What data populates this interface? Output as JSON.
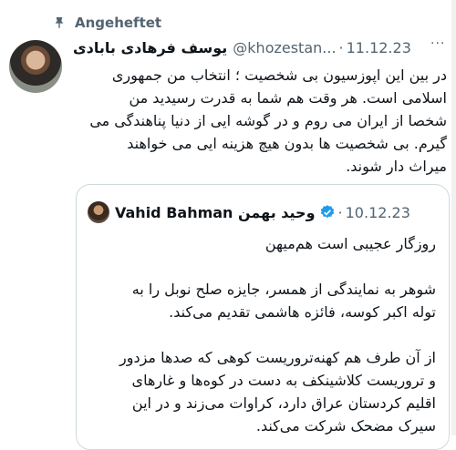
{
  "pinned": {
    "label": "Angeheftet"
  },
  "tweet": {
    "name": "یوسف فرهادی بابادی",
    "handle": "@khozestan...",
    "separator": "·",
    "date": "11.12.23",
    "more": "···",
    "text": "در بین این اپوزسیون بی شخصیت ؛ انتخاب من جمهوری\nاسلامی است. هر وقت هم شما به قدرت رسیدید من\nشخصا از ایران می روم و در گوشه ایی از دنیا پناهندگی می\nگیرم. بی شخصیت ها بدون هیچ هزینه ایی می خواهند\nمیراث دار شوند."
  },
  "quote": {
    "name": "Vahid Bahman وحید بهمن",
    "separator": "·",
    "date": "10.12.23",
    "paragraphs": [
      "روزگار عجیبی است هم‌میهن",
      "شوهر به نمایندگی از همسر، جایزه صلح نوبل را به\nتوله اکبر کوسه، فائزه هاشمی تقدیم می‌کند.",
      "از آن طرف هم کهنه‌تروریست کوهی که صدها مزدور\nو تروریست کلاشینکف به دست در کوه‌ها و غارهای\nاقلیم کردستان عراق دارد، کراوات می‌زند و در این\nسیرک مضحک شرکت می‌کند."
    ]
  },
  "colors": {
    "text": "#0f1419",
    "muted": "#536471",
    "verified": "#1d9bf0",
    "border": "#cfd9de"
  }
}
